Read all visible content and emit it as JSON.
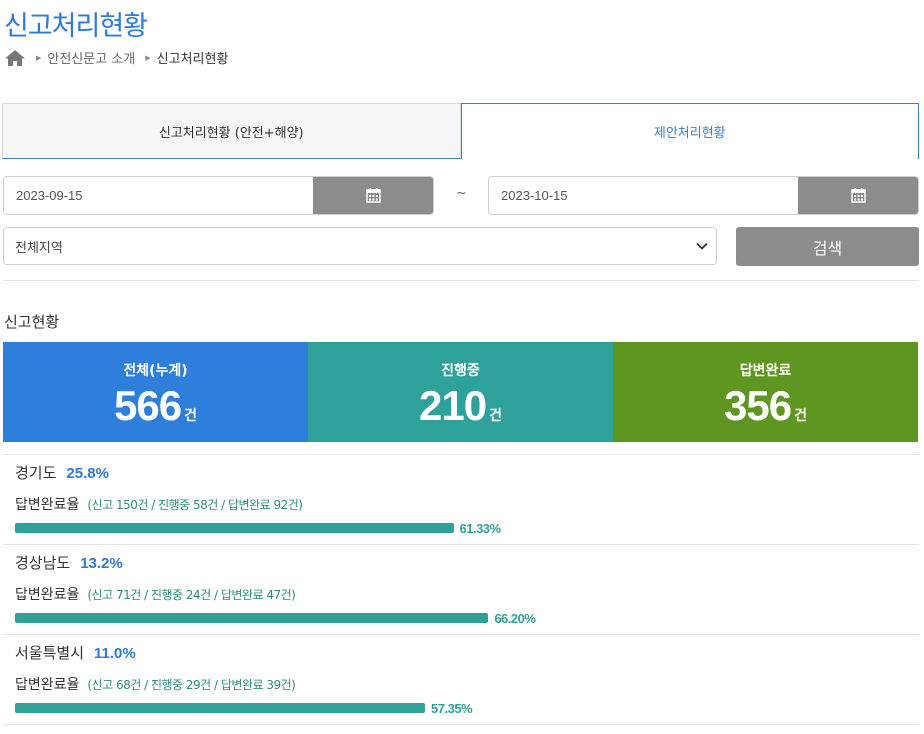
{
  "page": {
    "title": "신고처리현황"
  },
  "breadcrumb": {
    "items": [
      "안전신문고 소개",
      "신고처리현황"
    ]
  },
  "tabs": [
    {
      "label": "신고처리현황 (안전+해양)"
    },
    {
      "label": "제안처리현황"
    }
  ],
  "filters": {
    "start_date": "2023-09-15",
    "end_date": "2023-10-15",
    "separator": "~",
    "region": "전체지역",
    "search_label": "검색"
  },
  "summary": {
    "title": "신고현황",
    "unit": "건",
    "cards": [
      {
        "label": "전체(누계)",
        "value": "566",
        "color": "#2e7fdc"
      },
      {
        "label": "진행중",
        "value": "210",
        "color": "#2fa19b"
      },
      {
        "label": "답변완료",
        "value": "356",
        "color": "#5f9622"
      }
    ]
  },
  "regions": [
    {
      "name": "경기도",
      "share": "25.8%",
      "rate_label": "답변완료율",
      "detail": "(신고 150건 / 진행중 58건 / 답변완료 92건)",
      "rate": "61.33%",
      "rate_value": 61.33
    },
    {
      "name": "경상남도",
      "share": "13.2%",
      "rate_label": "답변완료율",
      "detail": "(신고 71건 / 진행중 24건 / 답변완료 47건)",
      "rate": "66.20%",
      "rate_value": 66.2
    },
    {
      "name": "서울특별시",
      "share": "11.0%",
      "rate_label": "답변완료율",
      "detail": "(신고 68건 / 진행중 29건 / 답변완료 39건)",
      "rate": "57.35%",
      "rate_value": 57.35
    }
  ],
  "icons": {
    "home": "home-icon",
    "calendar": "calendar-icon",
    "dropdown": "chevron-down-icon"
  }
}
